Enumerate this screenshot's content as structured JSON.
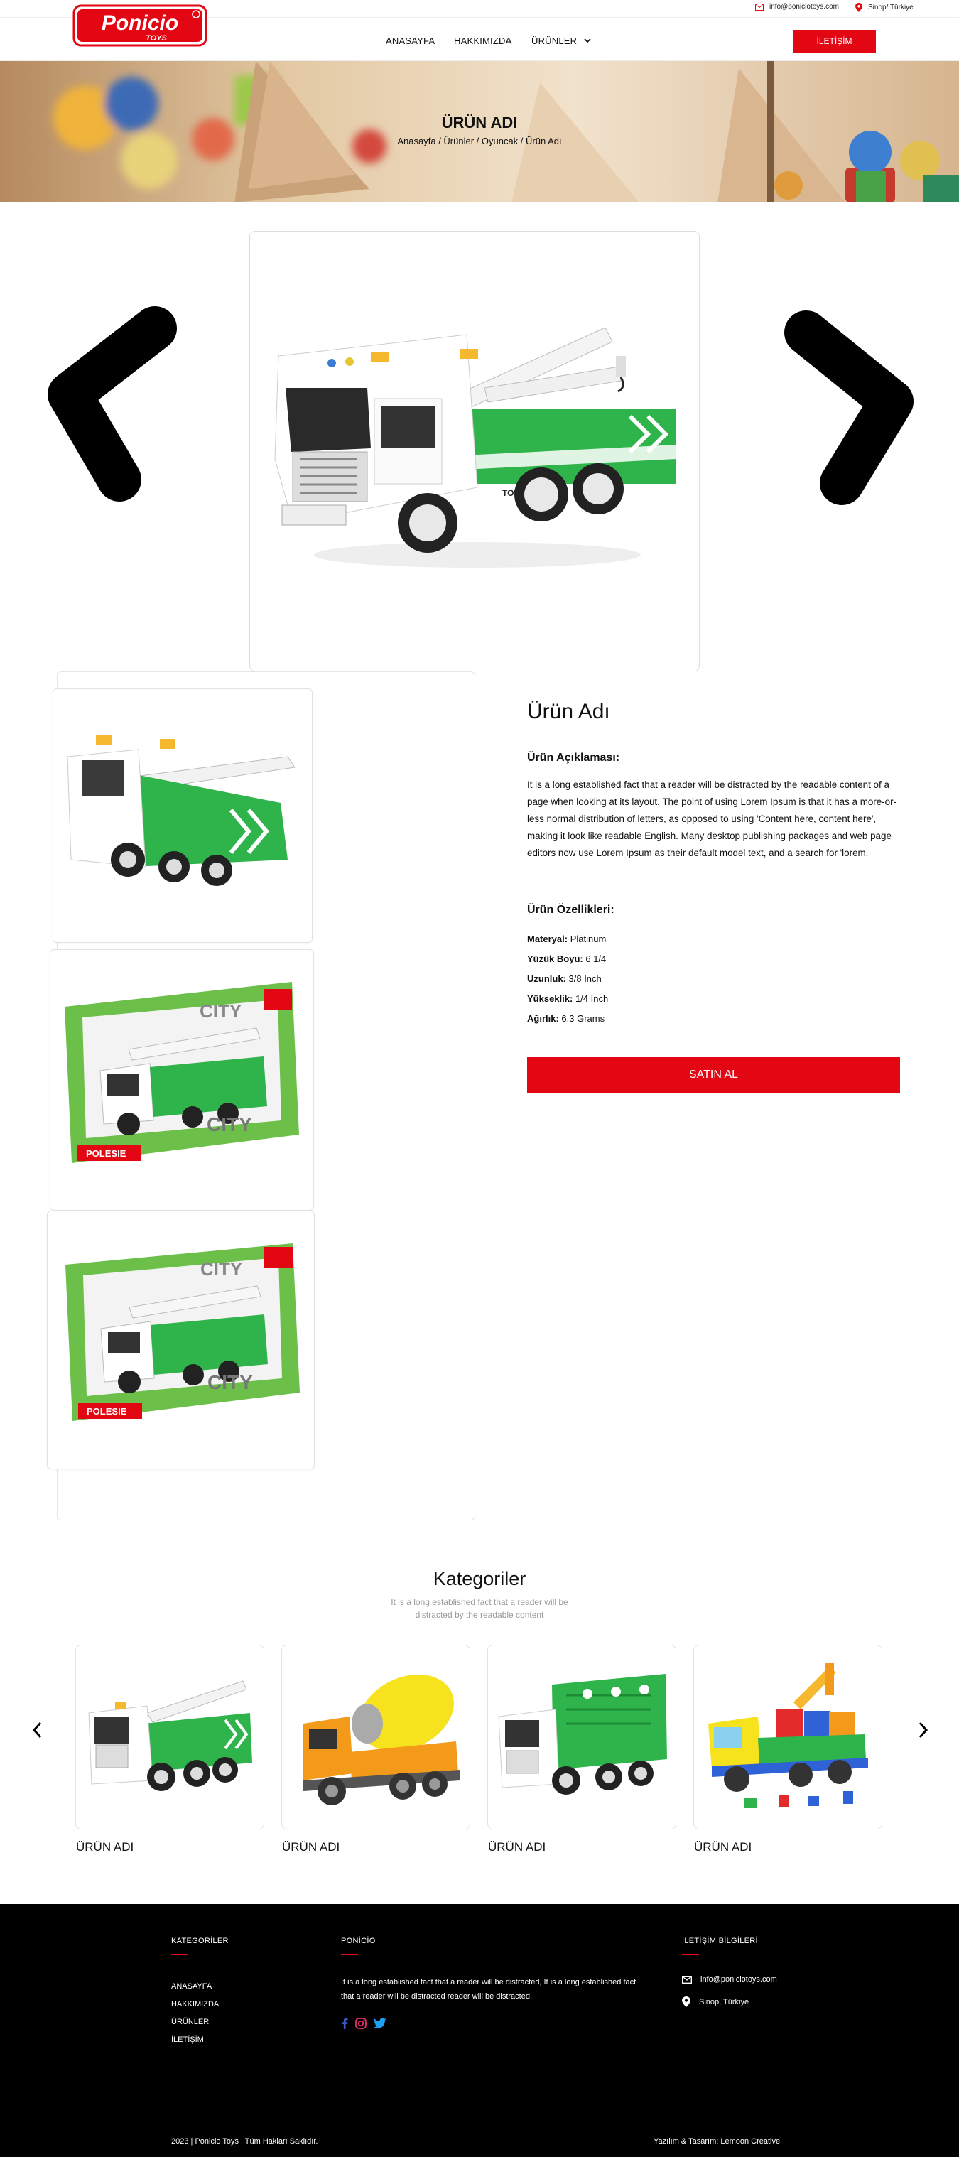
{
  "topbar": {
    "email": "info@poniciotoys.com",
    "location": "Sinop/ Türkiye"
  },
  "header": {
    "logo_text": "Ponicio",
    "logo_sub": "TOYS",
    "nav": [
      "ANASAYFA",
      "HAKKIMIZDA",
      "ÜRÜNLER"
    ],
    "contact_label": "İLETİŞİM"
  },
  "hero": {
    "title": "ÜRÜN ADI",
    "breadcrumb": "Anasayfa / Ürünler / Oyuncak / Ürün Adı"
  },
  "product": {
    "title": "Ürün Adı",
    "desc_heading": "Ürün Açıklaması:",
    "description": "It is a long established fact that a reader will be distracted by the readable content of a page when looking at its layout. The point of using Lorem Ipsum is that it has a more-or-less normal distribution of letters, as opposed to using 'Content here, content here', making it look like readable English. Many desktop publishing packages and web page editors now use Lorem Ipsum as their default model text, and a search for 'lorem.",
    "features_heading": "Ürün Özellikleri:",
    "specs": [
      {
        "label": "Materyal:",
        "value": "Platinum"
      },
      {
        "label": "Yüzük Boyu:",
        "value": "6 1/4"
      },
      {
        "label": "Uzunluk:",
        "value": "3/8 Inch"
      },
      {
        "label": "Yükseklik:",
        "value": "1/4 Inch"
      },
      {
        "label": "Ağırlık:",
        "value": "6.3 Grams"
      }
    ],
    "buy_label": "SATIN AL",
    "box_brand": "POLESIE",
    "box_series": "CITY",
    "truck_label": "TOW TRUCK"
  },
  "categories": {
    "title": "Kategoriler",
    "subtitle": "It is a long established fact that a reader will be distracted by the readable content",
    "items": [
      {
        "name": "ÜRÜN ADI"
      },
      {
        "name": "ÜRÜN ADI"
      },
      {
        "name": "ÜRÜN ADI"
      },
      {
        "name": "ÜRÜN ADI"
      }
    ]
  },
  "footer": {
    "col1_heading": "KATEGORİLER",
    "col1_links": [
      "ANASAYFA",
      "HAKKIMIZDA",
      "ÜRÜNLER",
      "İLETİŞİM"
    ],
    "col2_heading": "PONİCİO",
    "col2_text": "It is a long established fact that a reader will be distracted, It is a long established fact that a reader will be distracted reader will be distracted.",
    "col3_heading": "İLETİŞİM BİLGİLERİ",
    "email": "info@poniciotoys.com",
    "location": "Sinop, Türkiye",
    "copyright": "2023 | Ponicio Toys | Tüm Hakları Saklıdır.",
    "credits": "Yazılım & Tasarım: Lemoon Creative"
  },
  "colors": {
    "brand_red": "#e30613",
    "truck_green": "#2eb44a",
    "footer_bg": "#000000"
  }
}
